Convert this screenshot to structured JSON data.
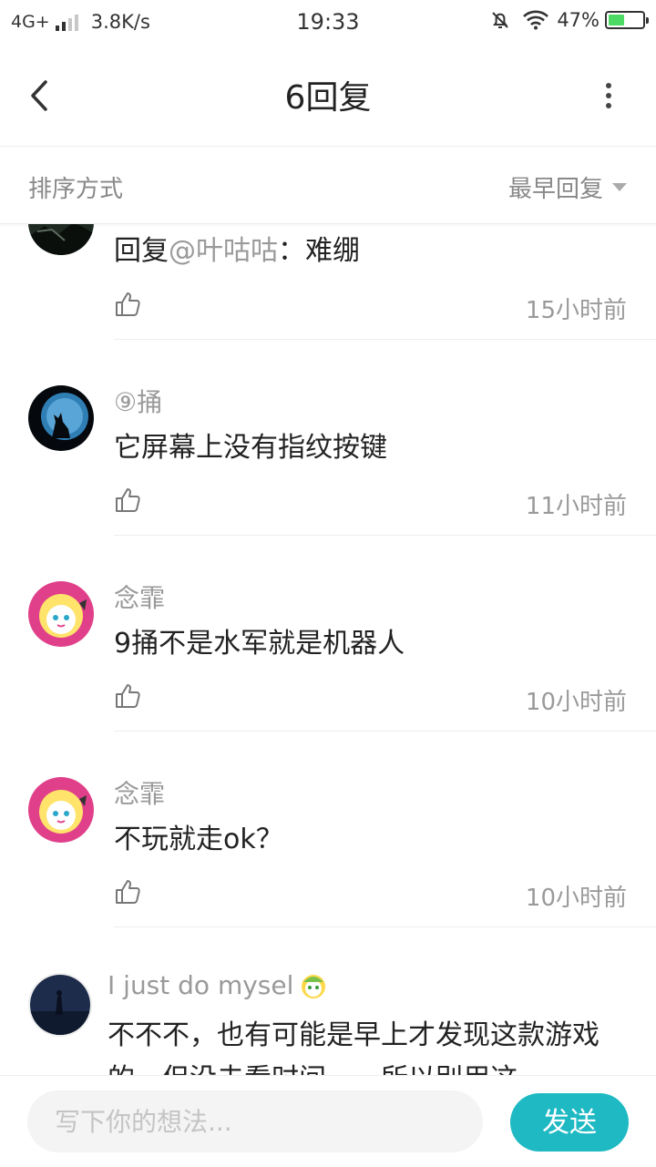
{
  "status_bar": {
    "network": "4G+",
    "speed": "3.8K/s",
    "time": "19:33",
    "battery": "47%",
    "battery_level": 0.47,
    "icons": [
      "signal-icon",
      "mute-bell-icon",
      "wifi-icon",
      "battery-icon"
    ]
  },
  "header": {
    "title": "6回复",
    "back_icon": "chevron-left-icon",
    "more_icon": "more-vertical-icon"
  },
  "sort": {
    "label": "排序方式",
    "selected": "最早回复"
  },
  "replies": [
    {
      "username": "",
      "reply_prefix": "回复",
      "mention": "@叶咕咕",
      "text": "：难绷",
      "time": "15小时前",
      "avatar": "dark-photo-avatar"
    },
    {
      "username": "⑨捅",
      "text": "它屏幕上没有指纹按键",
      "time": "11小时前",
      "avatar": "wolf-moon-avatar"
    },
    {
      "username": "念霏",
      "text": "9捅不是水军就是机器人",
      "time": "10小时前",
      "avatar": "anime-girl-avatar"
    },
    {
      "username": "念霏",
      "text": "不玩就走ok？",
      "time": "10小时前",
      "avatar": "anime-girl-avatar"
    },
    {
      "username": "I just do mysel",
      "text": "不不不，也有可能是早上才发现这款游戏的，但没去看时间……所以别用这",
      "avatar": "night-scene-avatar"
    }
  ],
  "composer": {
    "placeholder": "写下你的想法...",
    "send_label": "发送"
  },
  "colors": {
    "accent": "#1fb9c4",
    "muted_text": "#9a9a9a"
  }
}
